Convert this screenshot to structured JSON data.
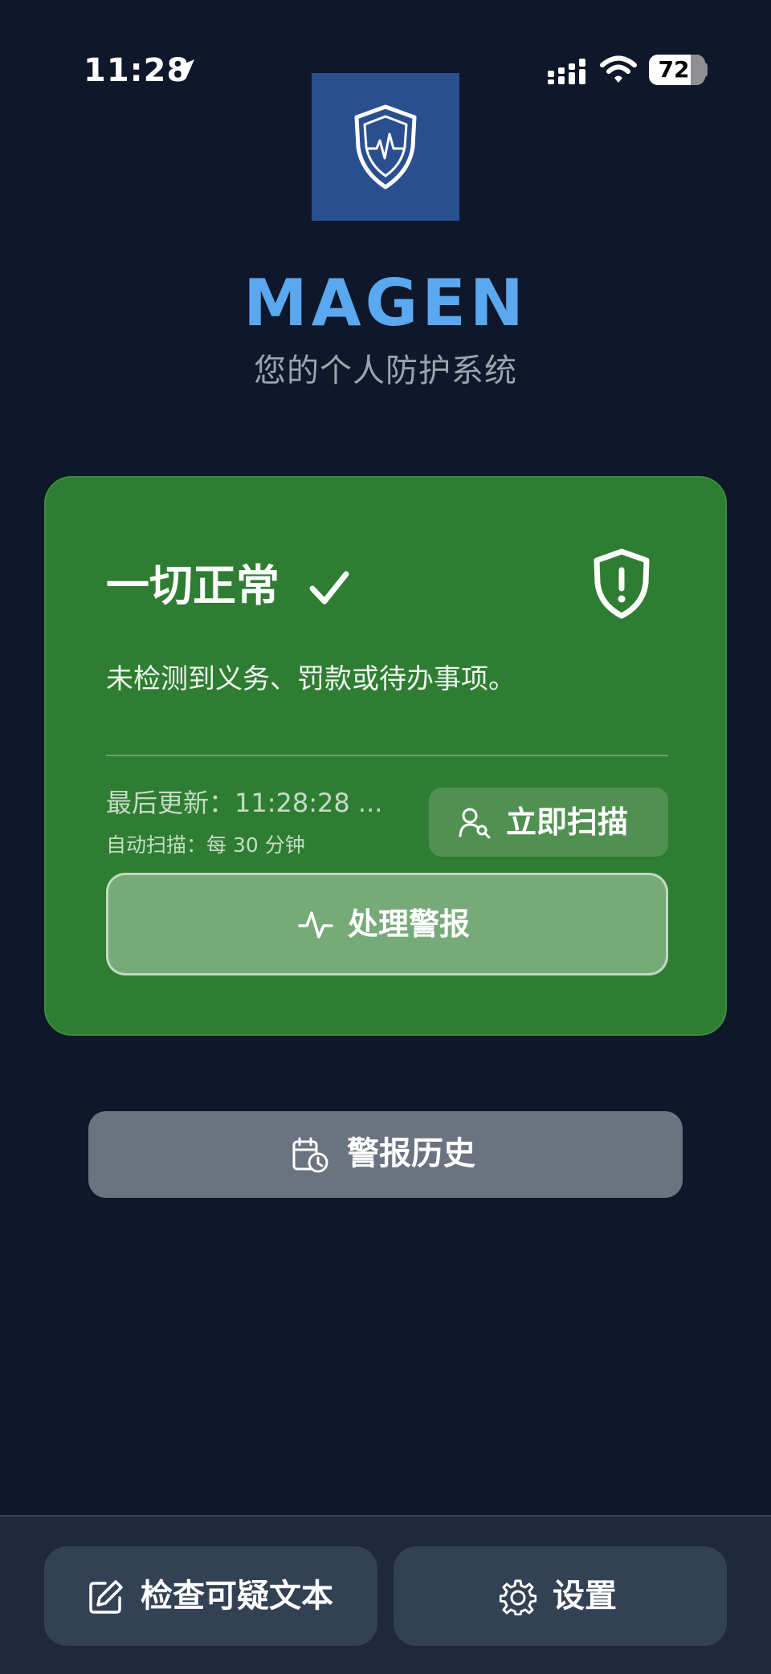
{
  "status_bar": {
    "time": "11:28",
    "battery": "72"
  },
  "app": {
    "title": "MAGEN",
    "subtitle": "您的个人防护系统"
  },
  "status_card": {
    "title": "一切正常",
    "message": "未检测到义务、罚款或待办事项。",
    "last_update": "最后更新：11:28:28 ...",
    "auto_scan": "自动扫描：每 30 分钟",
    "scan_button": "立即扫描",
    "alerts_button": "处理警报"
  },
  "history_button": "警报历史",
  "bottom_nav": {
    "check_text": "检查可疑文本",
    "settings": "设置"
  },
  "icons": {
    "location": "location-arrow-icon",
    "signal": "cellular-signal-icon",
    "wifi": "wifi-icon",
    "app_logo": "shield-heartbeat-icon",
    "status_check": "checkmark-icon",
    "status_shield": "shield-alert-icon",
    "scan": "user-search-icon",
    "alerts": "activity-pulse-icon",
    "history": "calendar-clock-icon",
    "edit": "edit-icon",
    "settings": "gear-icon"
  },
  "colors": {
    "background": "#0f172a",
    "card_green": "#2f7d32",
    "title_blue": "#5aa8f0",
    "history_gray": "#6b7280",
    "bottom_bar": "#1e293b"
  }
}
